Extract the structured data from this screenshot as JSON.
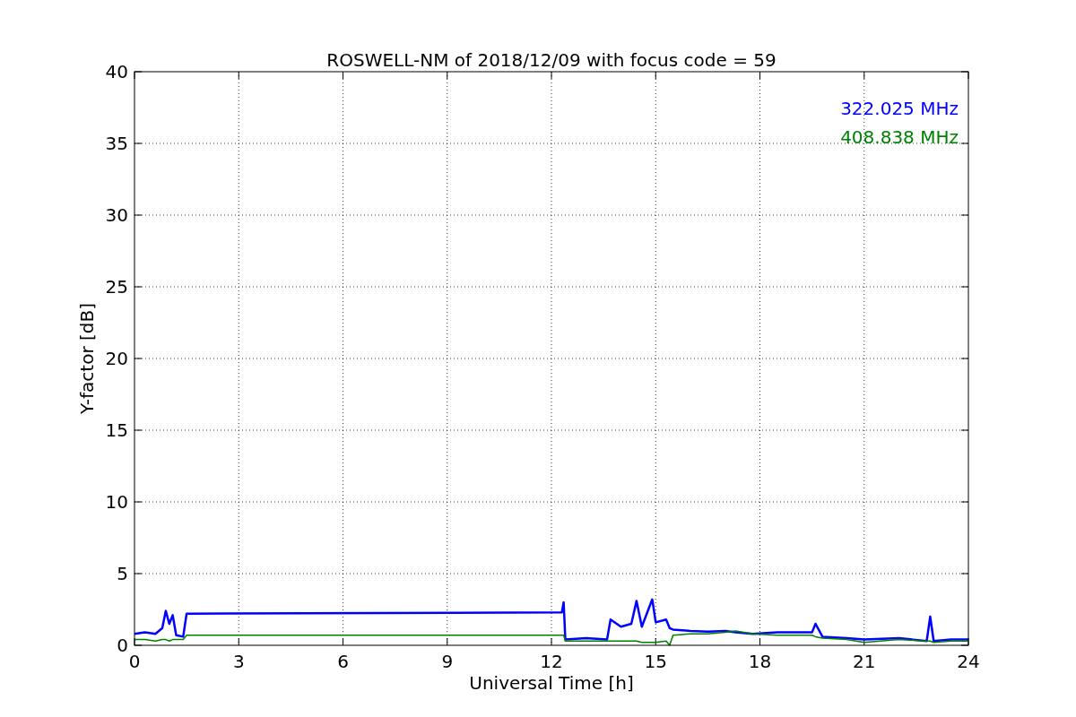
{
  "chart_data": {
    "type": "line",
    "title": "ROSWELL-NM of 2018/12/09 with focus code = 59",
    "xlabel": "Universal Time [h]",
    "ylabel": "Y-factor [dB]",
    "x": [
      0,
      0.3,
      0.6,
      0.8,
      0.9,
      1.0,
      1.1,
      1.2,
      1.4,
      1.5,
      12.3,
      12.35,
      12.4,
      13,
      13.6,
      13.7,
      14,
      14.3,
      14.45,
      14.6,
      14.9,
      15.0,
      15.3,
      15.4,
      15.5,
      16,
      16.5,
      17,
      17.3,
      17.8,
      18.5,
      19.5,
      19.6,
      19.8,
      20.5,
      21,
      22,
      22.8,
      22.9,
      23.0,
      23.5,
      24
    ],
    "series": [
      {
        "name": "322.025 MHz",
        "color": "#0000ff",
        "values": [
          0.8,
          0.9,
          0.8,
          1.2,
          2.4,
          1.5,
          2.1,
          0.7,
          0.6,
          2.2,
          2.3,
          3.0,
          0.4,
          0.5,
          0.4,
          1.8,
          1.3,
          1.5,
          3.1,
          1.3,
          3.2,
          1.6,
          1.8,
          1.2,
          1.1,
          1.0,
          0.95,
          1.0,
          0.9,
          0.8,
          0.9,
          0.9,
          1.5,
          0.6,
          0.5,
          0.4,
          0.5,
          0.3,
          2.0,
          0.3,
          0.4,
          0.4
        ]
      },
      {
        "name": "408.838 MHz",
        "color": "#008000",
        "values": [
          0.4,
          0.4,
          0.3,
          0.4,
          0.4,
          0.3,
          0.4,
          0.4,
          0.4,
          0.7,
          0.7,
          0.7,
          0.3,
          0.3,
          0.3,
          0.3,
          0.3,
          0.3,
          0.3,
          0.2,
          0.2,
          0.2,
          0.3,
          0.0,
          0.7,
          0.8,
          0.8,
          0.9,
          1.0,
          0.8,
          0.7,
          0.7,
          0.6,
          0.5,
          0.4,
          0.2,
          0.4,
          0.3,
          0.3,
          0.2,
          0.3,
          0.3
        ]
      }
    ],
    "xlim": [
      0,
      24
    ],
    "ylim": [
      0,
      40
    ],
    "xticks": [
      0,
      3,
      6,
      9,
      12,
      15,
      18,
      21,
      24
    ],
    "yticks": [
      0,
      5,
      10,
      15,
      20,
      25,
      30,
      35,
      40
    ],
    "grid": true
  }
}
